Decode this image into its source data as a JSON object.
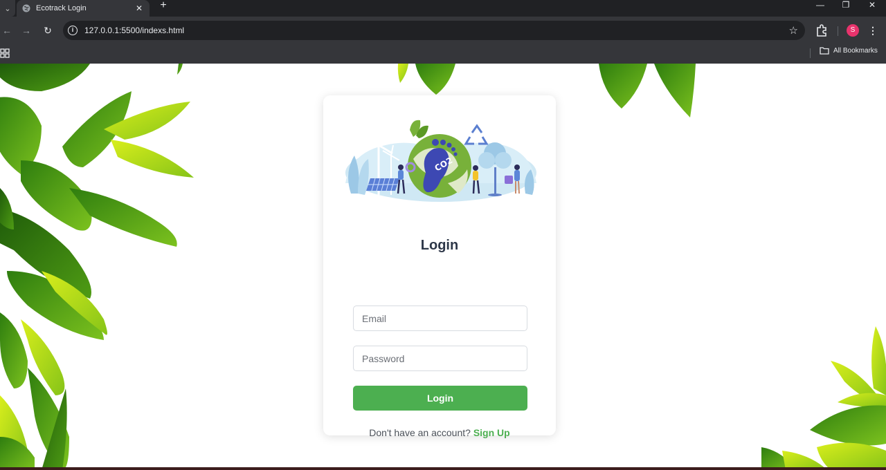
{
  "browser": {
    "tab_title": "Ecotrack Login",
    "url": "127.0.0.1:5500/indexs.html",
    "profile_initial": "S",
    "bookmarks_label": "All Bookmarks"
  },
  "login": {
    "heading": "Login",
    "email_placeholder": "Email",
    "password_placeholder": "Password",
    "submit_label": "Login",
    "signup_prompt": "Don't have an account?",
    "signup_link": "Sign Up"
  },
  "colors": {
    "accent": "#4caf50",
    "heading": "#2d3748",
    "avatar": "#e8336c"
  },
  "icons": [
    "tab-search-icon",
    "globe-icon",
    "close-icon",
    "plus-icon",
    "minimize-icon",
    "restore-icon",
    "back-icon",
    "forward-icon",
    "reload-icon",
    "info-icon",
    "star-icon",
    "extensions-icon",
    "more-icon",
    "apps-icon",
    "folder-icon"
  ]
}
